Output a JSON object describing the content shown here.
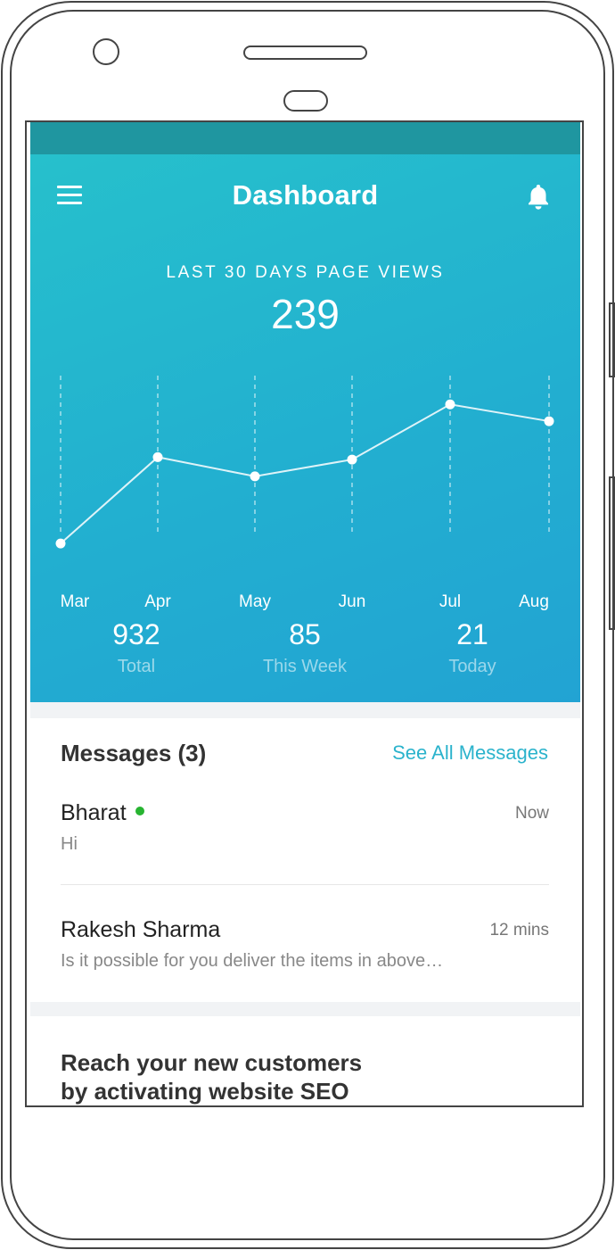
{
  "app_bar": {
    "title": "Dashboard",
    "menu_icon": "hamburger-menu-icon",
    "bell_icon": "bell-icon"
  },
  "hero": {
    "label": "LAST 30 DAYS PAGE VIEWS",
    "value": "239"
  },
  "chart_data": {
    "type": "line",
    "categories": [
      "Mar",
      "Apr",
      "May",
      "Jun",
      "Jul",
      "Aug"
    ],
    "values": [
      10,
      46,
      38,
      45,
      68,
      61
    ],
    "title": "",
    "xlabel": "",
    "ylabel": "",
    "ylim": [
      0,
      80
    ],
    "grid": "vertical dashed"
  },
  "stats": [
    {
      "value": "932",
      "label": "Total"
    },
    {
      "value": "85",
      "label": "This Week"
    },
    {
      "value": "21",
      "label": "Today"
    }
  ],
  "messages": {
    "heading": "Messages (3)",
    "see_all": "See All Messages",
    "items": [
      {
        "name": "Bharat",
        "online": true,
        "time": "Now",
        "preview": "Hi"
      },
      {
        "name": "Rakesh Sharma",
        "online": false,
        "time": "12 mins",
        "preview": "Is it possible for you deliver the items in above…"
      }
    ]
  },
  "promo": {
    "line1": "Reach your new customers",
    "line2": "by activating website SEO"
  },
  "colors": {
    "hero_start": "#26c0cc",
    "hero_end": "#22a3d3",
    "status_bar": "#1f96a0",
    "accent_link": "#2bb3cc",
    "online": "#27b431"
  }
}
